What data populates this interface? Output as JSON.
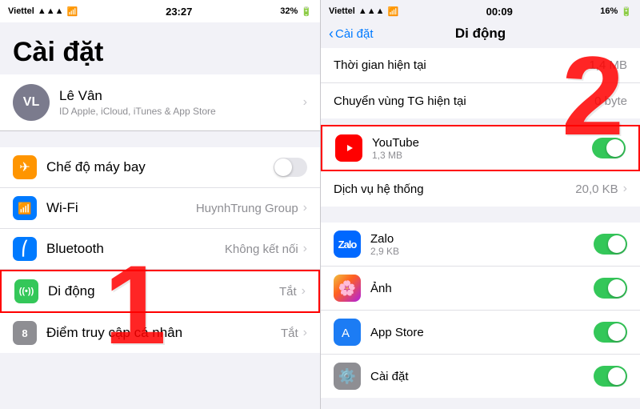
{
  "left": {
    "status": {
      "carrier": "Viettel",
      "time": "23:27",
      "battery": "32%"
    },
    "title": "Cài đặt",
    "profile": {
      "initials": "VL",
      "name": "Lê Vân",
      "subtitle": "ID Apple, iCloud, iTunes & App Store"
    },
    "items": [
      {
        "id": "airplane",
        "label": "Chế độ máy bay",
        "icon": "✈",
        "iconBg": "orange",
        "type": "toggle",
        "value": ""
      },
      {
        "id": "wifi",
        "label": "Wi-Fi",
        "icon": "📶",
        "iconBg": "blue",
        "type": "value",
        "value": "HuynhTrung Group"
      },
      {
        "id": "bluetooth",
        "label": "Bluetooth",
        "icon": "✱",
        "iconBg": "blue2",
        "type": "value",
        "value": "Không kết nối"
      },
      {
        "id": "didong",
        "label": "Di động",
        "icon": "((•))",
        "iconBg": "green",
        "type": "value",
        "value": "Tắt"
      },
      {
        "id": "hotspot",
        "label": "Điểm truy cập cá nhân",
        "icon": "8",
        "iconBg": "gray",
        "type": "value",
        "value": "Tắt"
      }
    ],
    "number": "1"
  },
  "right": {
    "status": {
      "carrier": "Viettel",
      "time": "00:09",
      "battery": "16%"
    },
    "back_label": "Cài đặt",
    "title": "Di động",
    "rows": [
      {
        "label": "Thời gian hiện tại",
        "value": "1,4 MB"
      },
      {
        "label": "Chuyển vùng TG hiện tại",
        "value": "0 byte"
      }
    ],
    "apps": [
      {
        "id": "youtube",
        "name": "YouTube",
        "size": "1,3 MB",
        "icon": "yt",
        "highlighted": true
      },
      {
        "id": "system",
        "label": "Dịch vụ hệ thống",
        "value": "20,0 KB"
      },
      {
        "id": "zalo",
        "name": "Zalo",
        "size": "2,9 KB",
        "icon": "zalo"
      },
      {
        "id": "anh",
        "name": "Ảnh",
        "size": "",
        "icon": "photos"
      },
      {
        "id": "appstore",
        "name": "App Store",
        "size": "",
        "icon": "appstore"
      },
      {
        "id": "caidat",
        "name": "Cài đặt",
        "size": "",
        "icon": "settings"
      }
    ],
    "number": "2"
  }
}
